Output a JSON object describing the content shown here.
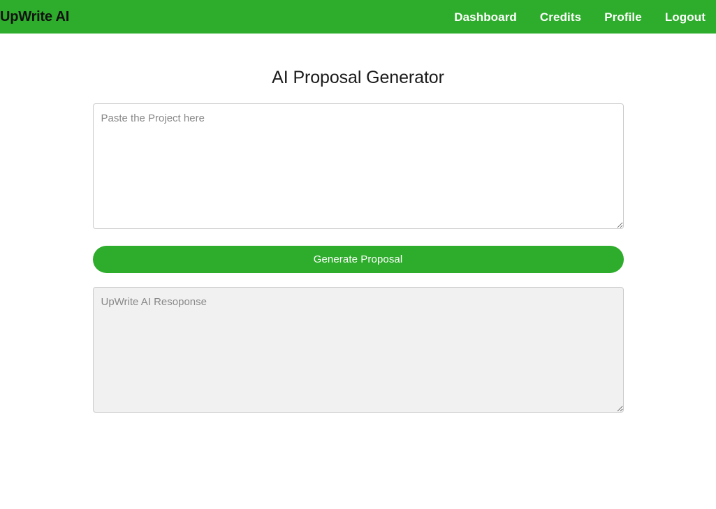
{
  "navbar": {
    "brand": "UpWrite AI",
    "links": [
      {
        "label": "Dashboard",
        "name": "nav-link-dashboard"
      },
      {
        "label": "Credits",
        "name": "nav-link-credits"
      },
      {
        "label": "Profile",
        "name": "nav-link-profile"
      },
      {
        "label": "Logout",
        "name": "nav-link-logout"
      }
    ],
    "background_color": "#2eac2b",
    "brand_color": "#111111",
    "link_color": "#ffffff"
  },
  "main": {
    "title": "AI Proposal Generator",
    "project_input": {
      "placeholder": "Paste the Project here",
      "value": ""
    },
    "generate_button": {
      "label": "Generate Proposal",
      "background_color": "#2eac2b",
      "text_color": "#ffffff"
    },
    "response_output": {
      "placeholder": "UpWrite AI Resoponse",
      "value": "",
      "background_color": "#f1f1f1"
    }
  }
}
